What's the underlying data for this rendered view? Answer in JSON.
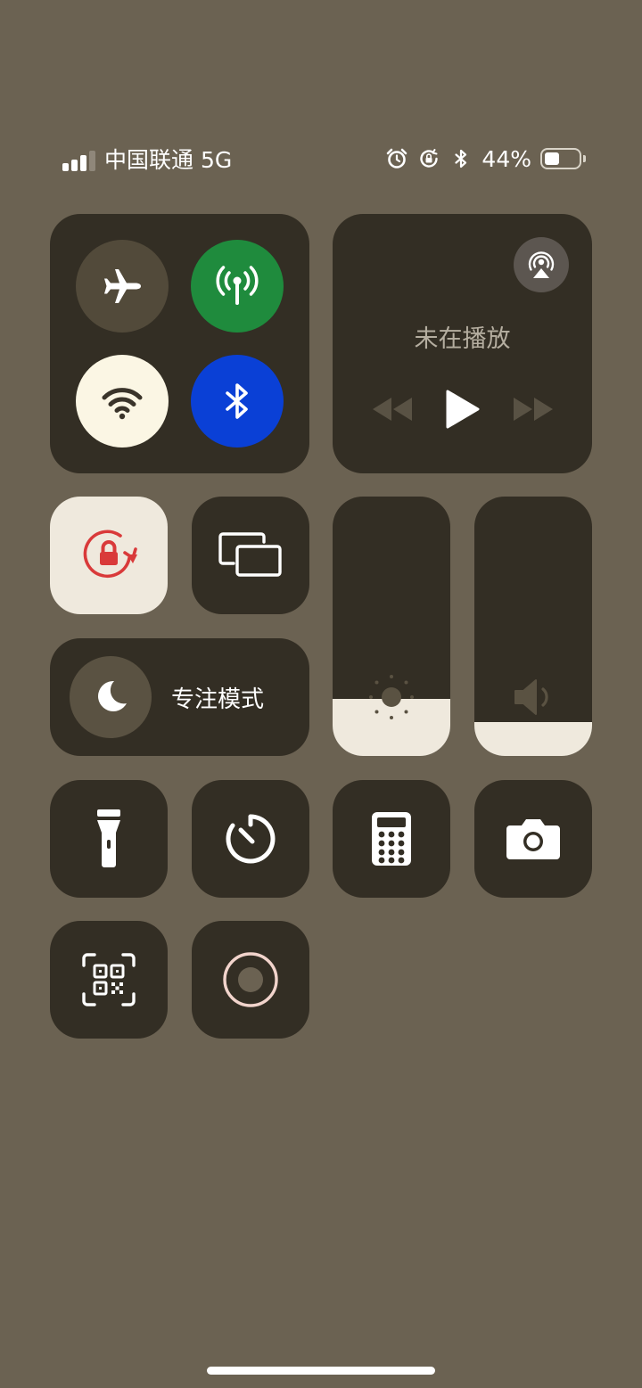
{
  "status_bar": {
    "carrier": "中国联通 5G",
    "battery_percent": "44%",
    "battery_level": 0.44,
    "signal_bars_active": 3,
    "signal_bars_total": 4,
    "icons": [
      "signal-icon",
      "alarm-icon",
      "rotation-lock-icon",
      "bluetooth-icon",
      "battery-icon"
    ]
  },
  "connectivity": {
    "airplane_mode": {
      "icon": "airplane-icon",
      "on": false,
      "color": "#524a3a"
    },
    "cellular_data": {
      "icon": "antenna-icon",
      "on": true,
      "color": "#1f8b3d"
    },
    "wifi": {
      "icon": "wifi-icon",
      "on": true,
      "color": "#fbf6e4"
    },
    "bluetooth": {
      "icon": "bluetooth-icon",
      "on": true,
      "color": "#0a40d6"
    }
  },
  "now_playing": {
    "title": "未在播放",
    "icons": [
      "airplay-audio-icon",
      "rewind-icon",
      "play-icon",
      "fast-forward-icon"
    ]
  },
  "toggles": {
    "orientation_lock": {
      "icon": "rotation-lock-icon",
      "on": true,
      "accent": "#d93a3a"
    },
    "screen_mirroring": {
      "icon": "screen-mirroring-icon"
    }
  },
  "focus": {
    "label": "专注模式",
    "icon": "moon-icon"
  },
  "sliders": {
    "brightness": {
      "icon": "sun-icon",
      "level": 0.22
    },
    "volume": {
      "icon": "speaker-icon",
      "level": 0.13
    }
  },
  "shortcuts": [
    {
      "name": "flashlight",
      "icon": "flashlight-icon"
    },
    {
      "name": "timer",
      "icon": "timer-icon"
    },
    {
      "name": "calculator",
      "icon": "calculator-icon"
    },
    {
      "name": "camera",
      "icon": "camera-icon"
    },
    {
      "name": "code-scanner",
      "icon": "qr-code-icon"
    },
    {
      "name": "screen-recording",
      "icon": "record-icon"
    }
  ],
  "colors": {
    "background": "#6b6252",
    "tile": "#332e24",
    "active_light": "#efe9dd"
  }
}
